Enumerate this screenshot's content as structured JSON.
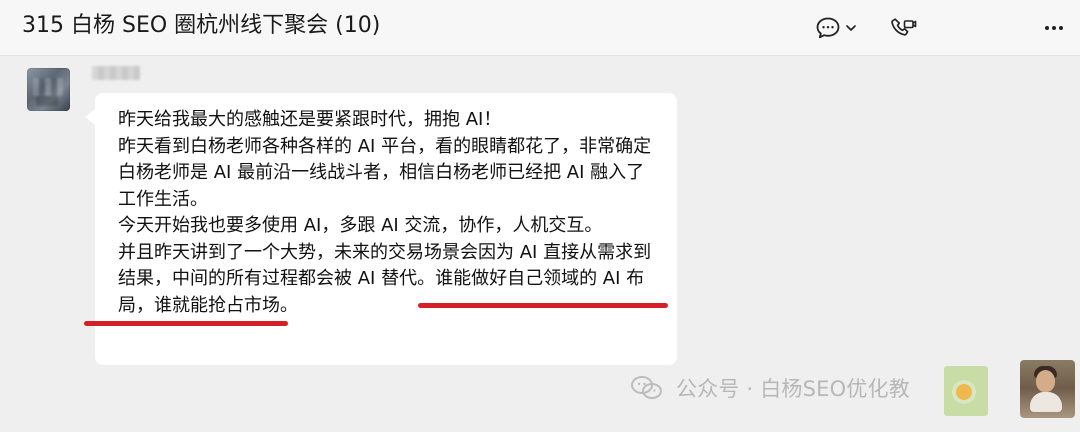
{
  "window": {
    "title": "315 白杨 SEO 圈杭州线下聚会 (10)"
  },
  "toolbar": {
    "icons": [
      "chat-bubble-icon",
      "chevron-down-icon",
      "phone-video-icon",
      "more-icon"
    ]
  },
  "chat": {
    "message": {
      "lines": [
        "昨天给我最大的感触还是要紧跟时代，拥抱 AI！",
        "昨天看到白杨老师各种各样的 AI 平台，看的眼睛都花了，非常确定",
        "白杨老师是 AI 最前沿一线战斗者，相信白杨老师已经把 AI 融入了",
        "工作生活。",
        "今天开始我也要多使用 AI，多跟 AI 交流，协作，人机交互。",
        "并且昨天讲到了一个大势，未来的交易场景会因为 AI 直接从需求到",
        "结果，中间的所有过程都会被 AI 替代。谁能做好自己领域的 AI 布",
        "局，谁就能抢占市场。"
      ]
    }
  },
  "overlay": {
    "watermark_text": "公众号 · 白杨SEO优化教",
    "colors": {
      "highlight": "#d62027",
      "bubble_bg": "#ffffff",
      "chat_bg": "#efefef"
    }
  }
}
